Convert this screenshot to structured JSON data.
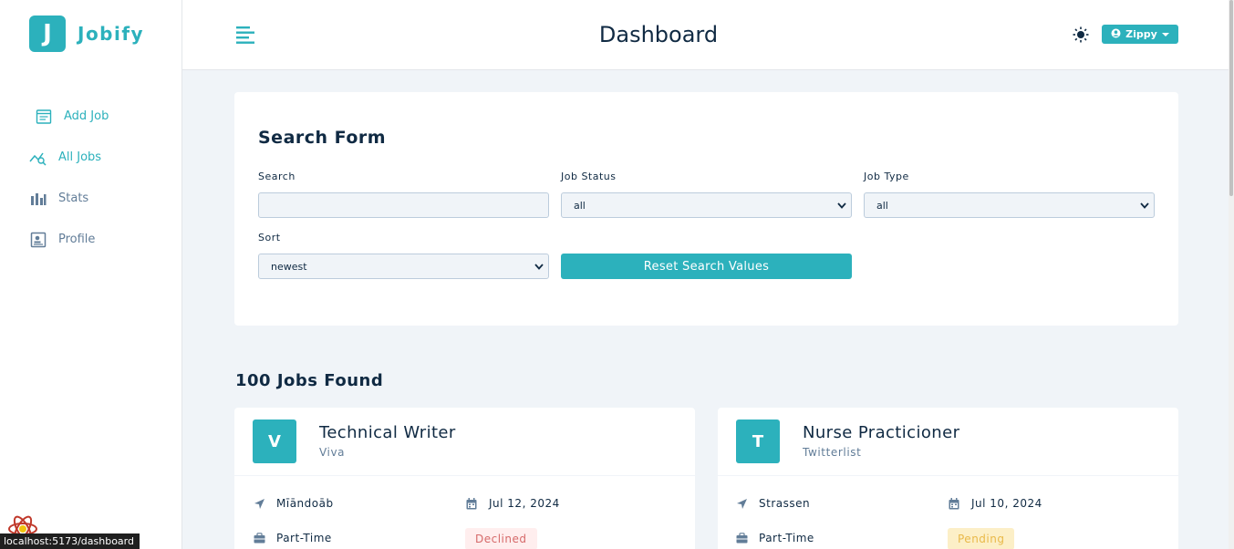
{
  "brand": {
    "logo_letter": "J",
    "name": "Jobify",
    "accent": "#2cb1bc"
  },
  "sidebar": {
    "items": [
      {
        "label": "Add Job",
        "icon": "add-job-icon",
        "active": true
      },
      {
        "label": "All Jobs",
        "icon": "all-jobs-icon",
        "active": true
      },
      {
        "label": "Stats",
        "icon": "stats-icon",
        "active": false
      },
      {
        "label": "Profile",
        "icon": "profile-icon",
        "active": false
      }
    ]
  },
  "header": {
    "title": "Dashboard",
    "user": "Zippy"
  },
  "search_form": {
    "title": "Search Form",
    "search_label": "Search",
    "search_value": "",
    "status_label": "Job Status",
    "status_value": "all",
    "type_label": "Job Type",
    "type_value": "all",
    "sort_label": "Sort",
    "sort_value": "newest",
    "reset_label": "Reset Search Values"
  },
  "jobs_found": "100 Jobs Found",
  "jobs": [
    {
      "initial": "V",
      "position": "Technical Writer",
      "company": "Viva",
      "location": "Mīāndoāb",
      "date": "Jul 12, 2024",
      "type": "Part-Time",
      "status": "Declined",
      "status_color": "#d66a6a"
    },
    {
      "initial": "T",
      "position": "Nurse Practicioner",
      "company": "Twitterlist",
      "location": "Strassen",
      "date": "Jul 10, 2024",
      "type": "Part-Time",
      "status": "Pending",
      "status_color": "#e9b949"
    }
  ],
  "browser_status": "localhost:5173/dashboard"
}
